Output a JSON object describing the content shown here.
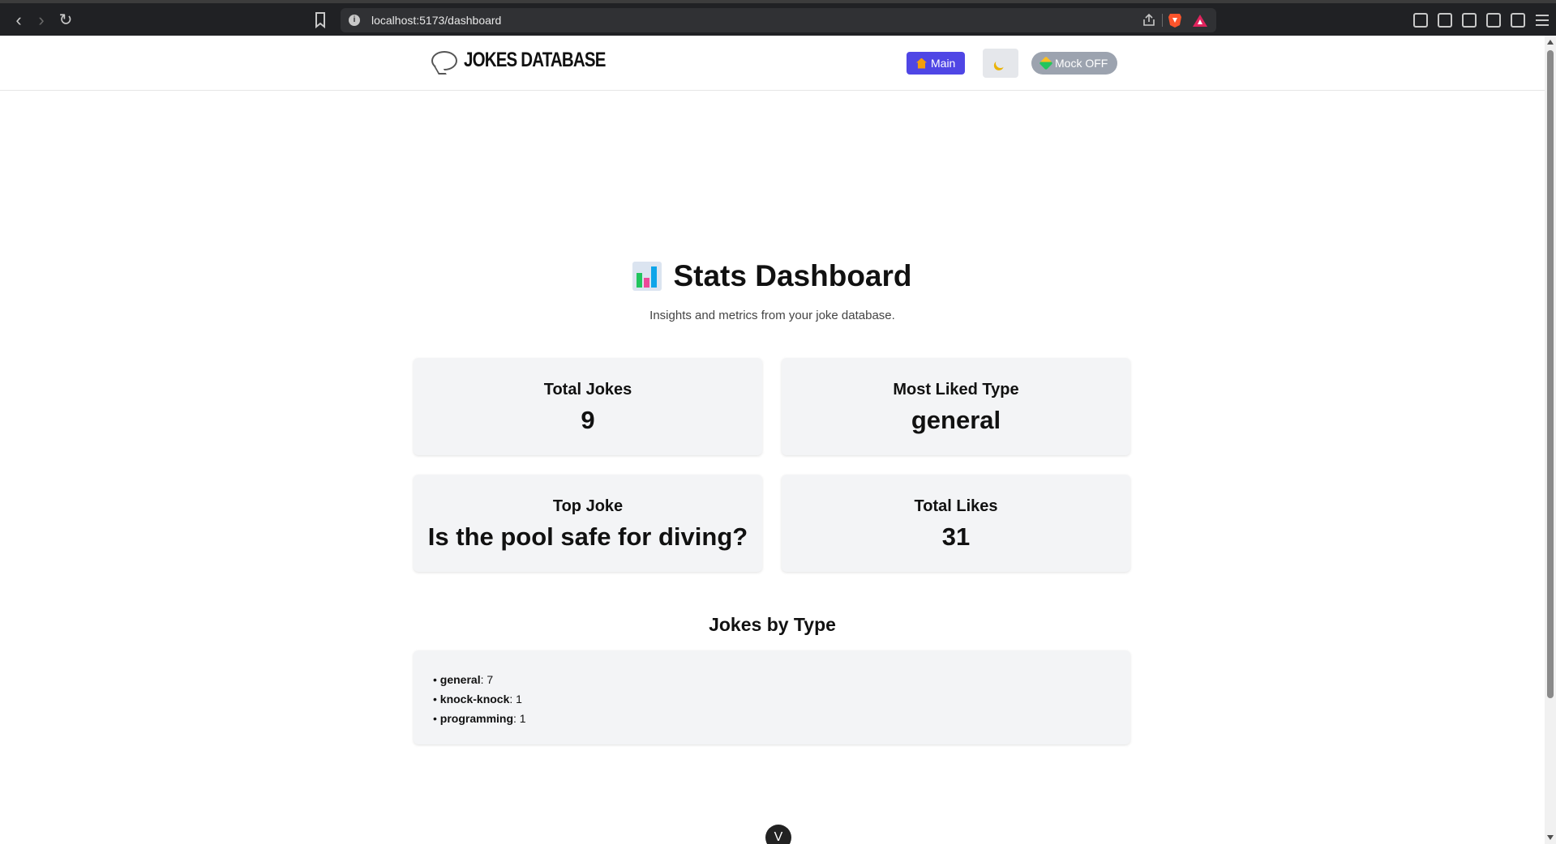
{
  "browser": {
    "url": "localhost:5173/dashboard"
  },
  "header": {
    "logo_text": "JOKES DATABASE",
    "main_label": "Main",
    "theme_icon": "moon-icon",
    "mock_label": "Mock OFF"
  },
  "dashboard": {
    "title": "Stats Dashboard",
    "subtitle": "Insights and metrics from your joke database.",
    "cards": [
      {
        "label": "Total Jokes",
        "value": "9"
      },
      {
        "label": "Most Liked Type",
        "value": "general"
      },
      {
        "label": "Top Joke",
        "value": "Is the pool safe for diving?"
      },
      {
        "label": "Total Likes",
        "value": "31"
      }
    ],
    "by_type_title": "Jokes by Type",
    "by_type": [
      {
        "type": "general",
        "count": ": 7"
      },
      {
        "type": "knock-knock",
        "count": ": 1"
      },
      {
        "type": "programming",
        "count": ": 1"
      }
    ]
  },
  "colors": {
    "primary": "#4f46e5",
    "mock_off": "#9ca3af",
    "card_bg": "#f3f4f6"
  }
}
